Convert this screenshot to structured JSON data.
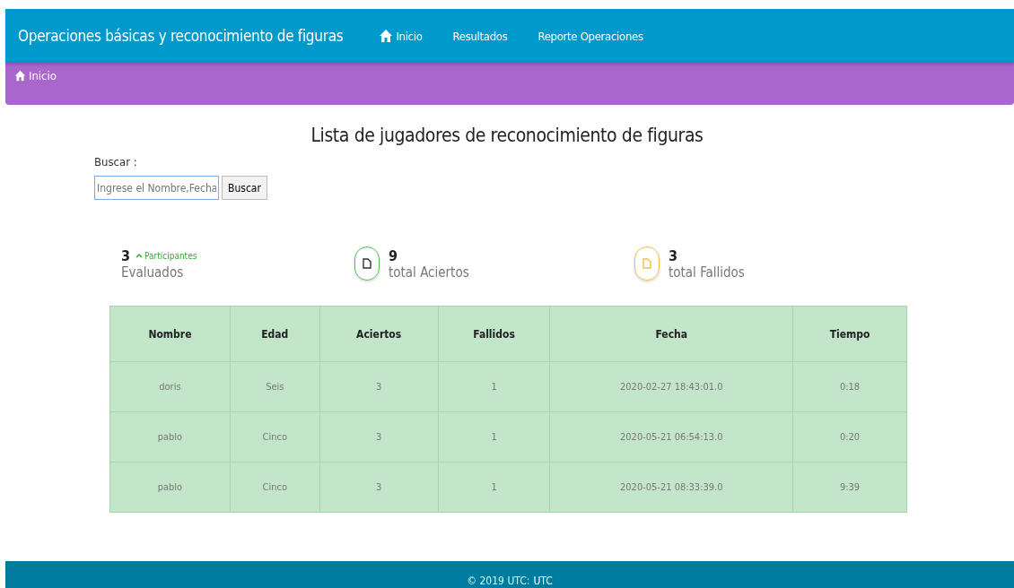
{
  "navbar": {
    "brand": "Operaciones básicas y reconocimiento de figuras",
    "links": [
      {
        "label": "Inicio",
        "kind": "home"
      },
      {
        "label": "Resultados",
        "kind": "plain"
      },
      {
        "label": "Reporte Operaciones",
        "kind": "plain"
      }
    ]
  },
  "breadcrumb": {
    "label": "Inicio"
  },
  "title": "Lista de jugadores de reconocimiento de figuras",
  "search": {
    "label": "Buscar :",
    "placeholder": "Ingrese el Nombre,Fecha",
    "button": "Buscar"
  },
  "stats": [
    {
      "kind": "trend",
      "value": "3",
      "trend": "Participantes",
      "label": "Evaluados"
    },
    {
      "kind": "icon",
      "value": "9",
      "label": "total Aciertos",
      "color": "#5cb85c"
    },
    {
      "kind": "icon",
      "value": "3",
      "label": "total Fallidos",
      "color": "#f0c040"
    }
  ],
  "table": {
    "columns": [
      "Nombre",
      "Edad",
      "Aciertos",
      "Fallidos",
      "Fecha",
      "Tiempo"
    ],
    "rows": [
      [
        "doris",
        "Seis",
        "3",
        "1",
        "2020-02-27 18:43:01.0",
        "0:18"
      ],
      [
        "pablo",
        "Cinco",
        "3",
        "1",
        "2020-05-21 06:54:13.0",
        "0:20"
      ],
      [
        "pablo",
        "Cinco",
        "3",
        "1",
        "2020-05-21 08:33:39.0",
        "9:39"
      ]
    ]
  },
  "footer": {
    "text": "© 2019 UTC:",
    "link": "UTC"
  }
}
